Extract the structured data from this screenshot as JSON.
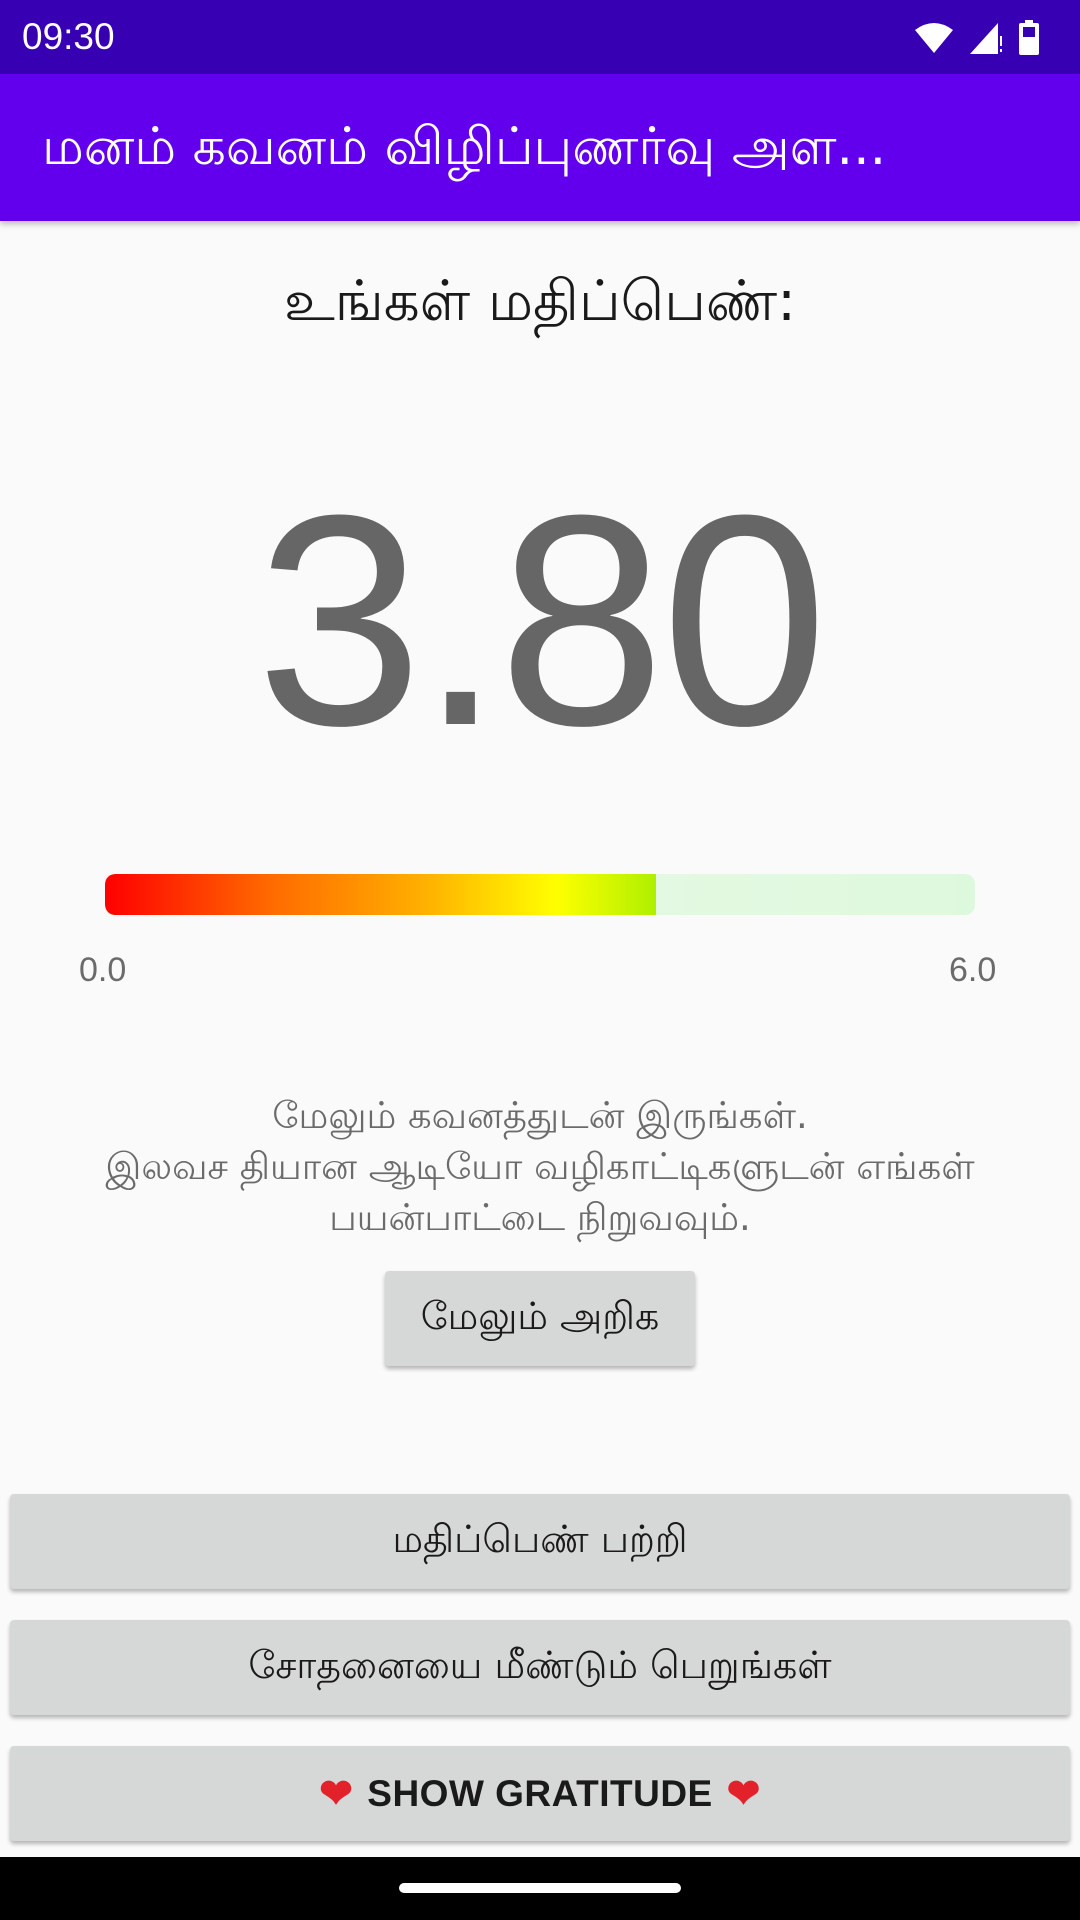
{
  "status_bar": {
    "time": "09:30",
    "icons": [
      "wifi-icon",
      "signal-icon",
      "battery-icon"
    ]
  },
  "app_bar": {
    "title": "மனம் கவனம் விழிப்புணர்வு அள..."
  },
  "score": {
    "label": "உங்கள் மதிப்பெண்:",
    "value_text": "3.80",
    "value": 3.8,
    "min": 0.0,
    "max": 6.0,
    "min_label": "0.0",
    "max_label": "6.0"
  },
  "advice": {
    "line1": "மேலும் கவனத்துடன் இருங்கள்.",
    "line2": "இலவச தியான ஆடியோ வழிகாட்டிகளுடன் எங்கள் பயன்பாட்டை நிறுவவும்."
  },
  "buttons": {
    "learn_more": "மேலும் அறிக",
    "about_score": "மதிப்பெண் பற்றி",
    "retake_test": "சோதனையை மீண்டும் பெறுங்கள்",
    "show_gratitude": "SHOW GRATITUDE",
    "gratitude_icon": "heart-icon"
  },
  "colors": {
    "status_bar": "#3700b3",
    "app_bar": "#6200ee",
    "button_bg": "#d6d7d7",
    "heart": "#e2212b"
  }
}
